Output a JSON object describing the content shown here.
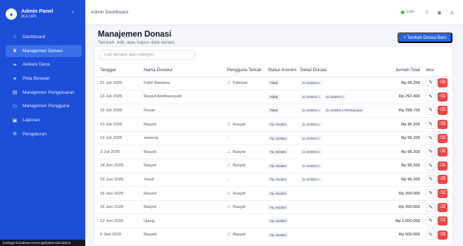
{
  "app": {
    "title": "Admin Panel",
    "subtitle": "IKA UPI"
  },
  "sidebar": {
    "items": [
      {
        "label": "Dashboard",
        "icon": "home-icon",
        "glyph": "⌂",
        "active": false
      },
      {
        "label": "Manajemen Donasi",
        "icon": "gift-icon",
        "glyph": "❦",
        "active": true
      },
      {
        "label": "Alokasi Dana",
        "icon": "hand-coins-icon",
        "glyph": "❧",
        "active": false
      },
      {
        "label": "Peta Beswan",
        "icon": "people-icon",
        "glyph": "✶",
        "active": false
      },
      {
        "label": "Manajemen Pengeluaran",
        "icon": "receipt-icon",
        "glyph": "▤",
        "active": false
      },
      {
        "label": "Manajemen Pengguna",
        "icon": "users-icon",
        "glyph": "⚇",
        "active": false
      },
      {
        "label": "Laporan",
        "icon": "report-icon",
        "glyph": "▣",
        "active": false
      },
      {
        "label": "Pengaturan",
        "icon": "gear-icon",
        "glyph": "✲",
        "active": false
      }
    ],
    "footer_url": "lumbago-bocalewa.vercel.app/admin/donations"
  },
  "topbar": {
    "title": "Admin Dashboard",
    "live_label": "Live"
  },
  "page": {
    "title": "Manajemen Donasi",
    "subtitle": "Tambah, edit, atau hapus data donasi.",
    "add_button": "+ Tambah Donasi Baru"
  },
  "search": {
    "placeholder": "Cari donatur atau kategori...",
    "value": ""
  },
  "table": {
    "headers": [
      "Tanggal",
      "Nama Donatur",
      "Pengguna Terkait",
      "Status Anonim",
      "Detail Donasi",
      "Jumlah Total",
      "Aksi"
    ],
    "rows": [
      {
        "date": "21 Juli 2025",
        "name": "Fahri Maulana",
        "user": "Fahrizal",
        "status": "Tidak",
        "details": [
          "1x Seleksi 1"
        ],
        "total": "Rp 96.200"
      },
      {
        "date": "14 Juli 2025",
        "name": "Rasyid Andikaresyah",
        "user": "",
        "status": "Tidak",
        "details": [
          "1x Seleksi 1",
          "2x Seleksi 2"
        ],
        "total": "Rp 292.400"
      },
      {
        "date": "13 Juli 2025",
        "name": "Pesan",
        "user": "",
        "status": "Tidak",
        "details": [
          "1x Seleksi 1",
          "2x Seleksi 2 Pembiasaan"
        ],
        "total": "Rp 298.700"
      },
      {
        "date": "13 Juli 2025",
        "name": "Rasyid",
        "user": "Rasyid",
        "status": "Ya, Anonim",
        "details": [
          "1x Seleksi 1"
        ],
        "total": "Rp 96.200"
      },
      {
        "date": "13 Juli 2025",
        "name": "asweng",
        "user": "-",
        "status": "Ya, Anonim",
        "details": [
          "1x Seleksi 1"
        ],
        "total": "Rp 96.200"
      },
      {
        "date": "3 Juli 2025",
        "name": "Rasyid",
        "user": "Rasyid",
        "status": "Ya, Anonim",
        "details": [
          "1x Seleksi 1"
        ],
        "total": "Rp 96.200"
      },
      {
        "date": "24 Juni 2025",
        "name": "Rasyid",
        "user": "Rasyid",
        "status": "Ya, Anonim",
        "details": [
          "1x Seleksi 1"
        ],
        "total": "Rp 96.200"
      },
      {
        "date": "19 Juni 2025",
        "name": "Yusuf",
        "user": "-",
        "status": "Ya, Anonim",
        "details": [
          "1x Seleksi 1"
        ],
        "total": "Rp 96.200"
      },
      {
        "date": "16 Juni 2025",
        "name": "Rasyid",
        "user": "Rasyid",
        "status": "Ya, Anonim",
        "details": [],
        "total": "Rp 200.000"
      },
      {
        "date": "16 Juni 2025",
        "name": "Rasyid",
        "user": "Rasyid",
        "status": "Ya, Anonim",
        "details": [],
        "total": "Rp 200.000"
      },
      {
        "date": "12 Juni 2025",
        "name": "Ujang",
        "user": "",
        "status": "Ya, Anonim",
        "details": [],
        "total": "Rp 1.000.000"
      },
      {
        "date": "9 Juni 2025",
        "name": "Rasyid",
        "user": "Rasyid",
        "status": "Ya, Anonim",
        "details": [],
        "total": "Rp 500.000"
      }
    ]
  },
  "colors": {
    "primary": "#1d4ed8",
    "accent": "#2563eb",
    "danger": "#ef4444",
    "live": "#22c55e"
  }
}
